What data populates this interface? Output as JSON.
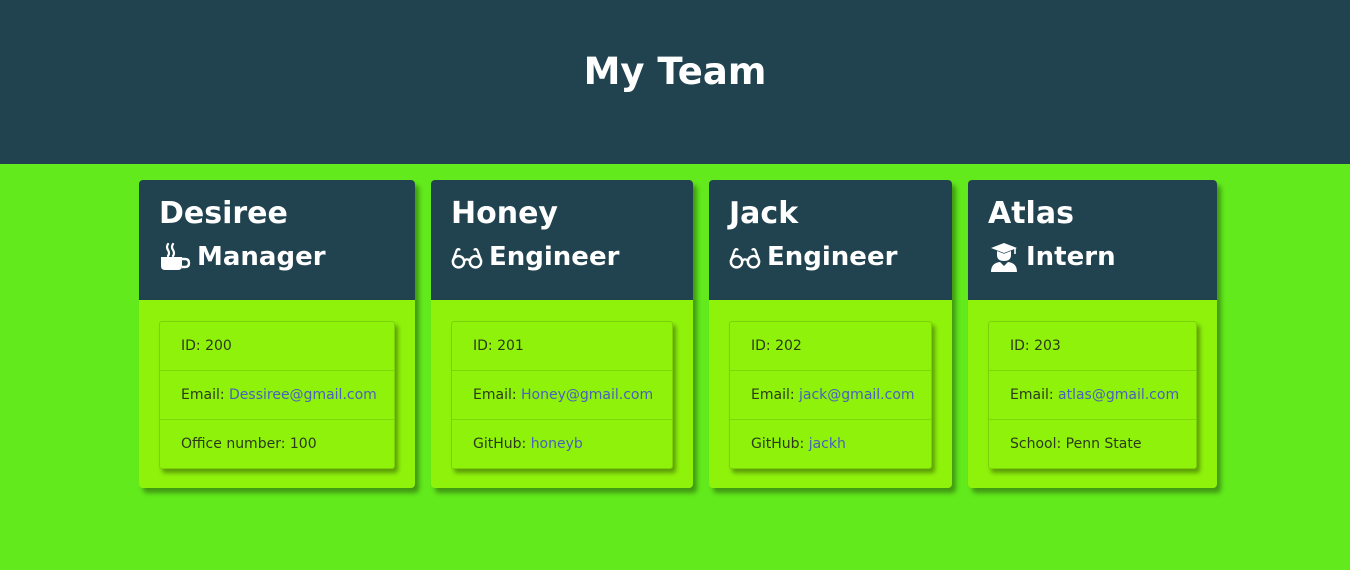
{
  "header": {
    "title": "My Team"
  },
  "colors": {
    "header_bg": "#21434f",
    "page_bg": "#62ea1c",
    "card_body_bg": "#8ef20b",
    "link": "#4b5fbf"
  },
  "cards": [
    {
      "name": "Desiree",
      "role": "Manager",
      "role_icon": "coffee-mug-icon",
      "id_label": "ID: ",
      "id": "200",
      "email_label": "Email: ",
      "email": "Dessiree@gmail.com",
      "extra_label": "Office number: ",
      "extra": "100"
    },
    {
      "name": "Honey",
      "role": "Engineer",
      "role_icon": "glasses-icon",
      "id_label": "ID: ",
      "id": "201",
      "email_label": "Email: ",
      "email": "Honey@gmail.com",
      "extra_label": "GitHub: ",
      "extra": "honeyb"
    },
    {
      "name": "Jack",
      "role": "Engineer",
      "role_icon": "glasses-icon",
      "id_label": "ID: ",
      "id": "202",
      "email_label": "Email: ",
      "email": "jack@gmail.com",
      "extra_label": "GitHub: ",
      "extra": "jackh"
    },
    {
      "name": "Atlas",
      "role": "Intern",
      "role_icon": "graduate-icon",
      "id_label": "ID: ",
      "id": "203",
      "email_label": "Email: ",
      "email": "atlas@gmail.com",
      "extra_label": "School: ",
      "extra": "Penn State"
    }
  ]
}
